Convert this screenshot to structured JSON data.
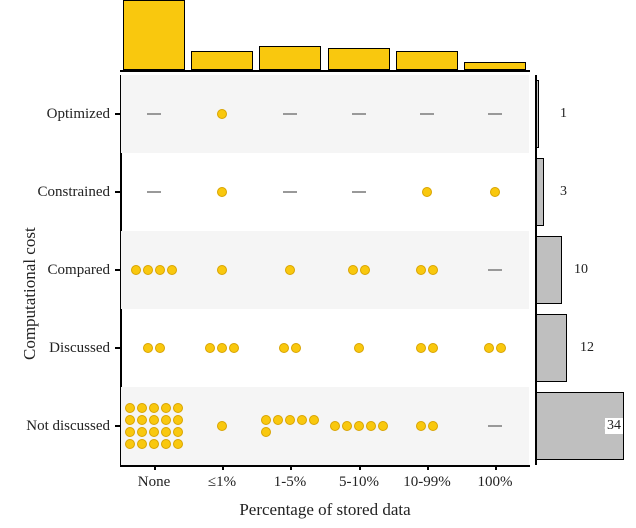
{
  "chart_data": {
    "type": "heatmap",
    "xlabel": "Percentage of stored data",
    "ylabel": "Computational cost",
    "x_categories": [
      "None",
      "≤1%",
      "1-5%",
      "5-10%",
      "10-99%",
      "100%"
    ],
    "y_categories": [
      "Optimized",
      "Constrained",
      "Compared",
      "Discussed",
      "Not discussed"
    ],
    "matrix_counts": [
      [
        0,
        1,
        0,
        0,
        0,
        0
      ],
      [
        0,
        1,
        0,
        0,
        1,
        1
      ],
      [
        4,
        1,
        1,
        2,
        2,
        0
      ],
      [
        2,
        3,
        2,
        1,
        2,
        2
      ],
      [
        20,
        1,
        6,
        5,
        2,
        0
      ]
    ],
    "row_totals": [
      1,
      3,
      10,
      12,
      34
    ],
    "col_totals": [
      26,
      7,
      9,
      8,
      7,
      3
    ],
    "colors": {
      "dots": "#f9c80e",
      "top_bars": "#f9c80e",
      "right_bars": "#bfbfbf"
    }
  }
}
